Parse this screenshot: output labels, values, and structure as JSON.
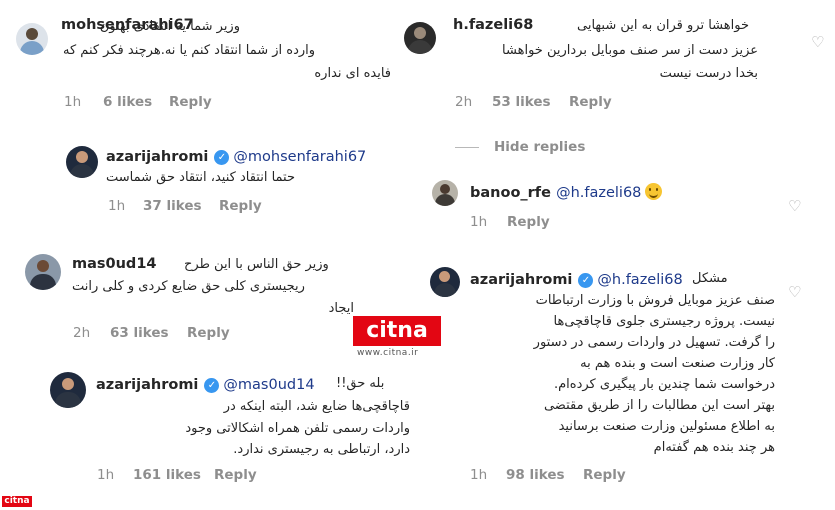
{
  "colors": {
    "accent": "#3897f0",
    "brand_red": "#e30613",
    "muted": "#8e8e8e",
    "mention": "#1e3a8a"
  },
  "left": {
    "c1": {
      "username": "mohsenfarahi67",
      "lines": [
        "وزیر شما یه انتقادی بهتون",
        "وارده از شما انتقاد کنم یا نه.هرچند فکر کنم که",
        "فایده ای نداره"
      ],
      "time": "1h",
      "likes": "6 likes",
      "reply": "Reply"
    },
    "c2": {
      "username": "azarijahromi",
      "mention": "@mohsenfarahi67",
      "lines": [
        "حتما انتقاد کنید، انتقاد حق شماست"
      ],
      "time": "1h",
      "likes": "37 likes",
      "reply": "Reply"
    },
    "c3": {
      "username": "mas0ud14",
      "lines": [
        "وزیر حق الناس با این طرح",
        "ریجیستری کلی حق ضایع کردی و کلی رانت",
        "ایجاد"
      ],
      "time": "2h",
      "likes": "63 likes",
      "reply": "Reply"
    },
    "c4": {
      "username": "azarijahromi",
      "mention": "@mas0ud14",
      "lines": [
        "بله حق!!",
        "قاچاقچی‌ها ضایع شد، البته اینکه در",
        "واردات رسمی تلفن همراه اشکالاتی وجود",
        "دارد، ارتباطی به رجیستری ندارد."
      ],
      "time": "1h",
      "likes": "161 likes",
      "reply": "Reply"
    }
  },
  "right": {
    "c1": {
      "username": "h.fazeli68",
      "lines": [
        "خواهشا ترو قران به این شبهایی",
        "عزیز دست از سر صنف موبایل بردارین خواهشا",
        "بخدا درست نیست"
      ],
      "time": "2h",
      "likes": "53 likes",
      "reply": "Reply"
    },
    "hide_replies": "Hide replies",
    "c2": {
      "username": "banoo_rfe",
      "mention": "@h.fazeli68",
      "time": "1h",
      "reply": "Reply"
    },
    "c3": {
      "username": "azarijahromi",
      "mention": "@h.fazeli68",
      "first_word": "مشکل",
      "lines": [
        "صنف عزیز موبایل فروش با وزارت ارتباطات",
        "نیست. پروژه رجیستری جلوی قاچاقچی‌ها",
        "را گرفت. تسهیل در واردات رسمی در دستور",
        "کار وزارت صنعت است و بنده هم به",
        "درخواست شما چندین بار پیگیری کرده‌ام.",
        "بهتر است این مطالبات را از طریق مقتضی",
        "به اطلاع مسئولین وزارت صنعت برسانید",
        "هر چند بنده هم گفته‌ام"
      ],
      "time": "1h",
      "likes": "98 likes",
      "reply": "Reply"
    }
  },
  "watermark": {
    "logo": "citna",
    "url": "www.citna.ir"
  },
  "corner_logo": "citna"
}
